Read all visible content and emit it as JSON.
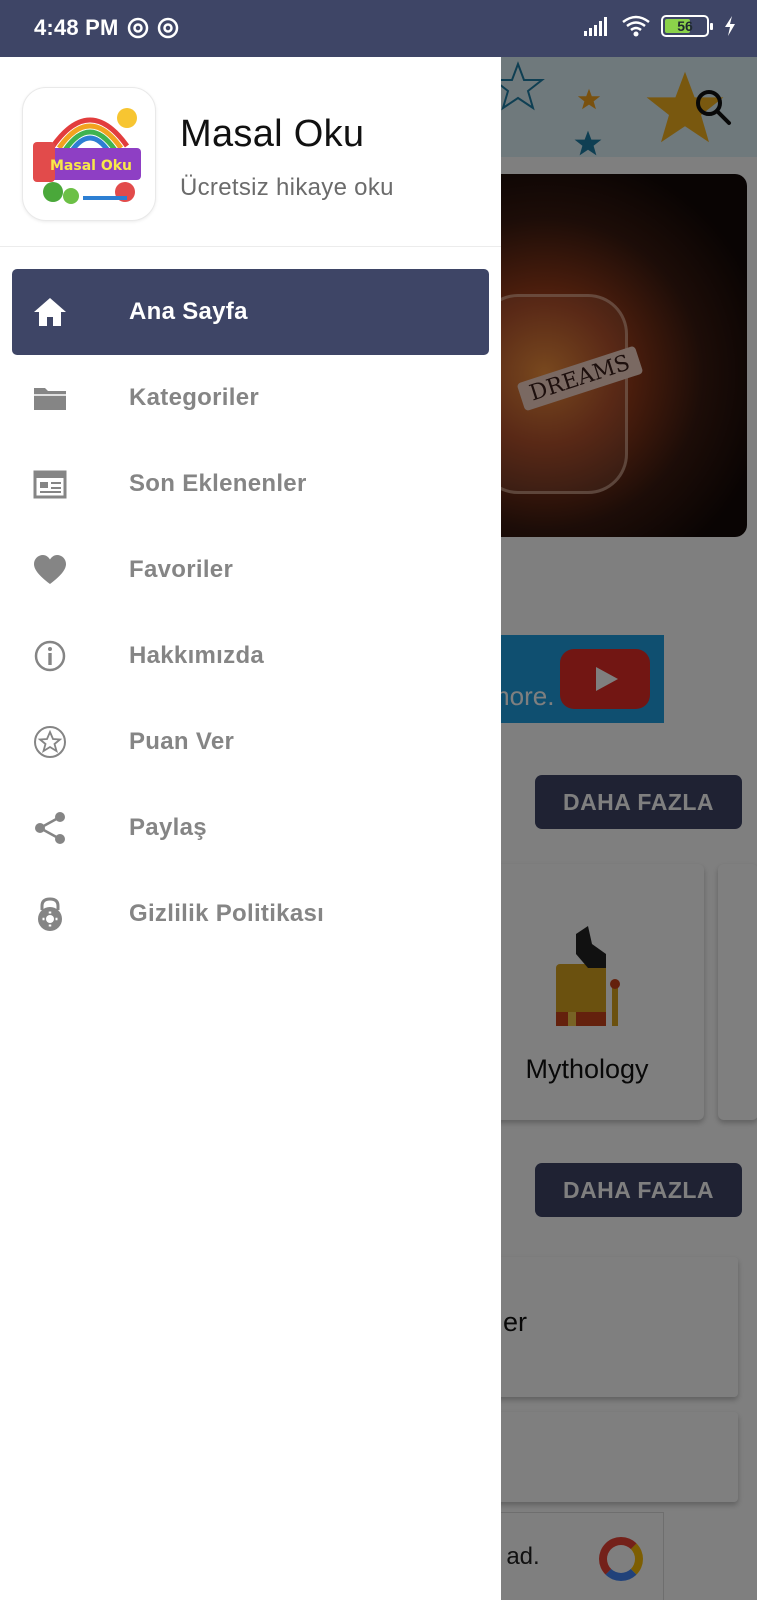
{
  "status_bar": {
    "time": "4:48 PM",
    "battery": "56",
    "icons": [
      "at-sign-icon",
      "at-sign-icon",
      "signal-icon",
      "wifi-icon",
      "battery-icon",
      "charging-icon"
    ]
  },
  "drawer": {
    "app_name": "Masal Oku",
    "app_subtitle": "Ücretsiz hikaye oku",
    "logo_text": "Masal Oku",
    "menu": [
      {
        "label": "Ana Sayfa",
        "icon": "home-icon",
        "active": true
      },
      {
        "label": "Kategoriler",
        "icon": "folder-icon",
        "active": false
      },
      {
        "label": "Son Eklenenler",
        "icon": "calendar-icon",
        "active": false
      },
      {
        "label": "Favoriler",
        "icon": "heart-icon",
        "active": false
      },
      {
        "label": "Hakkımızda",
        "icon": "info-icon",
        "active": false
      },
      {
        "label": "Puan Ver",
        "icon": "star-icon",
        "active": false
      },
      {
        "label": "Paylaş",
        "icon": "share-icon",
        "active": false
      },
      {
        "label": "Gizlilik Politikası",
        "icon": "lock-icon",
        "active": false
      }
    ]
  },
  "background": {
    "hero_text": "DREAMS",
    "banner_text": "more.",
    "more_button_1": "DAHA FAZLA",
    "more_button_2": "DAHA FAZLA",
    "category_title": "Mythology",
    "story_fragment": "er",
    "ad_text": "t ad."
  },
  "colors": {
    "primary": "#3e4566",
    "menu_text": "#858585",
    "active_text": "#ffffff"
  }
}
